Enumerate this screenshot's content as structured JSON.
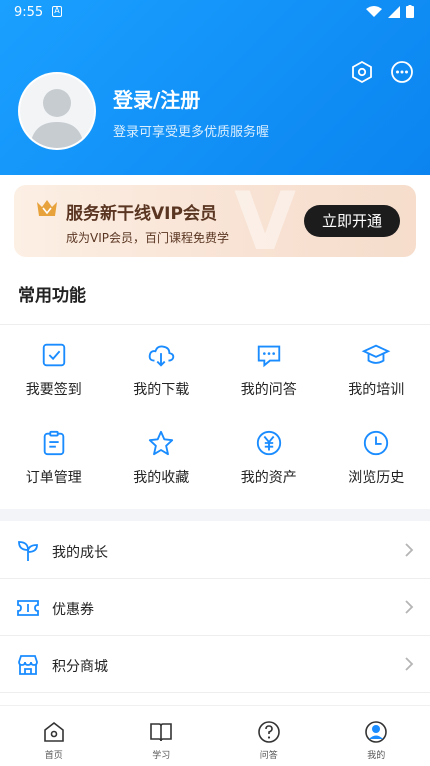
{
  "status_bar": {
    "time": "9:55",
    "a_icon": "A"
  },
  "profile": {
    "title": "登录/注册",
    "subtitle": "登录可享受更多优质服务喔"
  },
  "vip": {
    "title": "服务新干线VIP会员",
    "subtitle": "成为VIP会员，百门课程免费学",
    "button": "立即开通",
    "deco": "V"
  },
  "common": {
    "title": "常用功能",
    "items": [
      {
        "label": "我要签到",
        "icon": "checkin-icon"
      },
      {
        "label": "我的下载",
        "icon": "cloud-download-icon"
      },
      {
        "label": "我的问答",
        "icon": "chat-icon"
      },
      {
        "label": "我的培训",
        "icon": "graduation-cap-icon"
      },
      {
        "label": "订单管理",
        "icon": "clipboard-icon"
      },
      {
        "label": "我的收藏",
        "icon": "star-icon"
      },
      {
        "label": "我的资产",
        "icon": "yen-icon"
      },
      {
        "label": "浏览历史",
        "icon": "clock-icon"
      }
    ]
  },
  "list": [
    {
      "label": "我的成长",
      "icon": "sprout-icon"
    },
    {
      "label": "优惠券",
      "icon": "ticket-icon"
    },
    {
      "label": "积分商城",
      "icon": "store-icon"
    }
  ],
  "nav": [
    {
      "label": "首页",
      "icon": "home-icon"
    },
    {
      "label": "学习",
      "icon": "book-icon"
    },
    {
      "label": "问答",
      "icon": "question-icon"
    },
    {
      "label": "我的",
      "icon": "user-icon"
    }
  ],
  "colors": {
    "primary": "#0b84f0",
    "icon_blue": "#1a8cff",
    "vip_text": "#5a3622"
  }
}
